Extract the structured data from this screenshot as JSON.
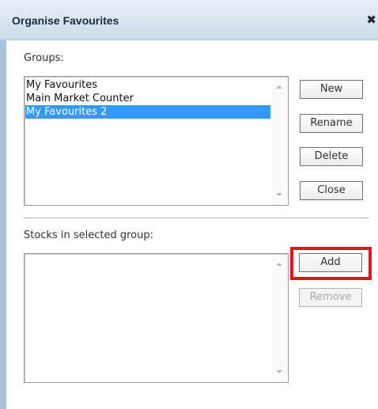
{
  "window": {
    "title": "Organise Favourites",
    "close_glyph": "✖"
  },
  "groups": {
    "label": "Groups:",
    "items": [
      {
        "label": "My Favourites",
        "selected": false
      },
      {
        "label": "Main Market Counter",
        "selected": false
      },
      {
        "label": "My Favourites 2",
        "selected": true
      }
    ]
  },
  "group_buttons": {
    "new": "New",
    "rename": "Rename",
    "delete": "Delete",
    "close": "Close"
  },
  "stocks": {
    "label": "Stocks in selected group:",
    "items": []
  },
  "stock_buttons": {
    "add": "Add",
    "remove": "Remove",
    "remove_enabled": false
  },
  "colors": {
    "selection": "#3399ff",
    "highlight": "#e3141b",
    "frame": "#a9c3de"
  }
}
